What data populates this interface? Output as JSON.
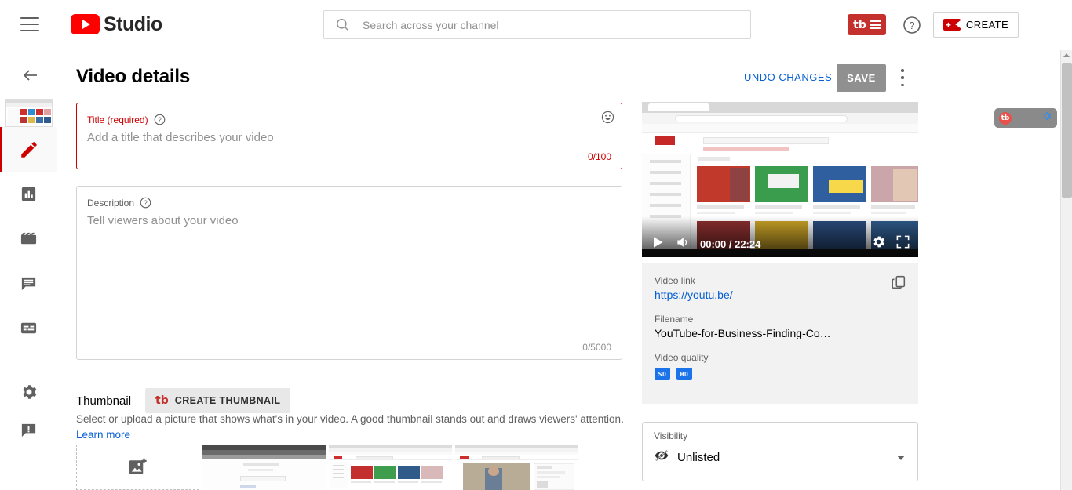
{
  "topbar": {
    "menu_label": "Menu",
    "brand_text": "Studio",
    "search_placeholder": "Search across your channel",
    "search_value": "",
    "tubebuddy_label": "tb",
    "help_label": "?",
    "create_label": "CREATE"
  },
  "header": {
    "page_title": "Video details",
    "undo_label": "UNDO CHANGES",
    "save_label": "SAVE"
  },
  "sidebar": {
    "items": [
      {
        "name": "video-thumbnail",
        "label": ""
      },
      {
        "name": "details",
        "label": "Details"
      },
      {
        "name": "analytics",
        "label": "Analytics"
      },
      {
        "name": "editor",
        "label": "Editor"
      },
      {
        "name": "comments",
        "label": "Comments"
      },
      {
        "name": "subtitles",
        "label": "Subtitles"
      },
      {
        "name": "settings",
        "label": "Settings"
      },
      {
        "name": "send-feedback",
        "label": "Send feedback"
      }
    ]
  },
  "title_field": {
    "label": "Title (required)",
    "placeholder": "Add a title that describes your video",
    "value": "",
    "counter": "0/100"
  },
  "description_field": {
    "label": "Description",
    "placeholder": "Tell viewers about your video",
    "value": "",
    "counter": "0/5000"
  },
  "thumbnail": {
    "section_label": "Thumbnail",
    "create_button_label": "CREATE THUMBNAIL",
    "description": "Select or upload a picture that shows what's in your video. A good thumbnail stands out and draws viewers' attention.",
    "learn_more": "Learn more",
    "options": [
      {
        "name": "upload-thumbnail",
        "selected": false
      },
      {
        "name": "auto-thumbnail-1",
        "selected": false
      },
      {
        "name": "auto-thumbnail-2",
        "selected": true
      },
      {
        "name": "auto-thumbnail-3",
        "selected": false
      }
    ]
  },
  "player": {
    "time_display": "00:00 / 22:24",
    "current_time": "00:00",
    "duration": "22:24"
  },
  "video_info": {
    "link_label": "Video link",
    "link_value": "https://youtu.be/",
    "filename_label": "Filename",
    "filename_value": "YouTube-for-Business-Finding-Co…",
    "quality_label": "Video quality",
    "quality_badges": [
      "SD",
      "HD"
    ]
  },
  "visibility": {
    "label": "Visibility",
    "value": "Unlisted"
  },
  "tubebuddy_widget": {
    "mark": "tb"
  },
  "colors": {
    "brand_red": "#ff0000",
    "tubebuddy_red": "#c4302b",
    "link_blue": "#065fd4",
    "required_red": "#cc0000",
    "save_gray": "#909090",
    "badge_blue": "#1a73e8",
    "panel_gray": "#f2f2f2"
  }
}
